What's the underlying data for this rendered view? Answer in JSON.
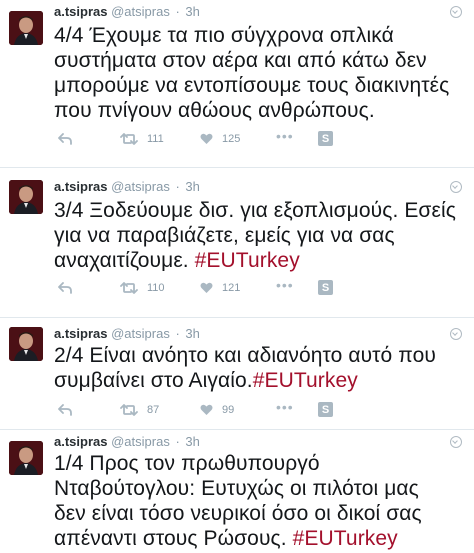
{
  "colors": {
    "hashtag": "#a3102c",
    "meta": "#8899a6",
    "icon": "#aab8c2",
    "divider": "#e1e8ed"
  },
  "tweets": [
    {
      "name": "a.tsipras",
      "handle": "@atsipras",
      "separator": "·",
      "time": "3h",
      "lines": [
        "4/4 Έχουμε τα πιο σύγχρονα οπλικά",
        "συστήματα στον αέρα και από κάτω δεν",
        "μπορούμε να εντοπίσουμε τους διακινητές",
        "που πνίγουν αθώους ανθρώπους."
      ],
      "hashtag": "",
      "retweets": "111",
      "likes": "125",
      "icons": [
        "reply-icon",
        "retweet-icon",
        "heart-icon",
        "more-icon",
        "s-app-icon"
      ]
    },
    {
      "name": "a.tsipras",
      "handle": "@atsipras",
      "separator": "·",
      "time": "3h",
      "lines": [
        "3/4 Ξοδεύουμε δισ. για εξοπλισμούς. Εσείς",
        "για να παραβιάζετε, εμείς για να σας",
        "αναχαιτίζουμε. "
      ],
      "hashtag": "#EUTurkey",
      "retweets": "110",
      "likes": "121",
      "icons": [
        "reply-icon",
        "retweet-icon",
        "heart-icon",
        "more-icon",
        "s-app-icon"
      ]
    },
    {
      "name": "a.tsipras",
      "handle": "@atsipras",
      "separator": "·",
      "time": "3h",
      "lines": [
        "2/4 Είναι ανόητο και αδιανόητο αυτό που",
        "συμβαίνει στο Αιγαίο."
      ],
      "hashtag": "#EUTurkey",
      "retweets": "87",
      "likes": "99",
      "icons": [
        "reply-icon",
        "retweet-icon",
        "heart-icon",
        "more-icon",
        "s-app-icon"
      ]
    },
    {
      "name": "a.tsipras",
      "handle": "@atsipras",
      "separator": "·",
      "time": "3h",
      "lines": [
        "1/4 Προς τον πρωθυπουργό",
        "Νταβούτογλου: Ευτυχώς οι πιλότοι μας",
        "δεν είναι τόσο νευρικοί όσο οι δικοί σας",
        "απέναντι στους Ρώσους. "
      ],
      "hashtag": "#EUTurkey"
    }
  ],
  "s_button_label": "S",
  "more_label": "•••"
}
